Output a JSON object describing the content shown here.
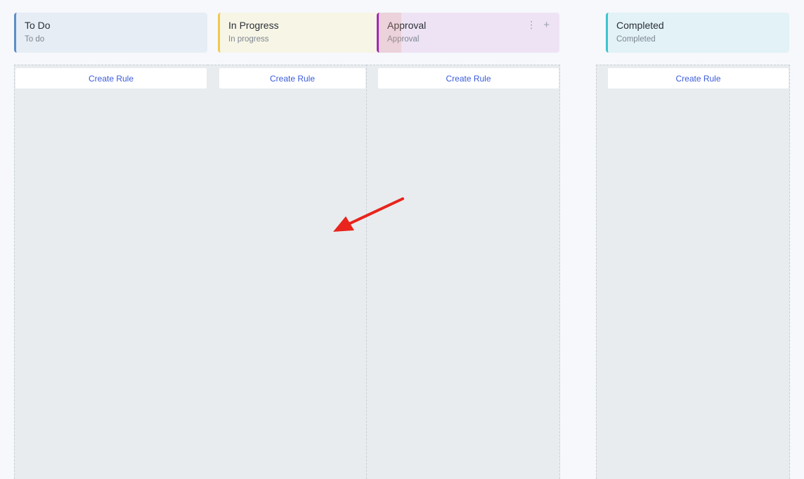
{
  "columns": [
    {
      "title": "To Do",
      "subtitle": "To do",
      "action": "Create Rule",
      "accent": "#5b8fc7"
    },
    {
      "title": "In Progress",
      "subtitle": "In progress",
      "action": "Create Rule",
      "accent": "#f2c94c"
    },
    {
      "title": "Approval",
      "subtitle": "Approval",
      "action": "Create Rule",
      "accent": "#a02bb5"
    },
    {
      "title": "Completed",
      "subtitle": "Completed",
      "action": "Create Rule",
      "accent": "#3cc4cf"
    }
  ],
  "approval_actions": {
    "menu_icon": "kebab-menu-icon",
    "add_icon": "plus-icon"
  },
  "annotation": {
    "icon": "red-arrow-icon",
    "color": "#e8241c"
  }
}
